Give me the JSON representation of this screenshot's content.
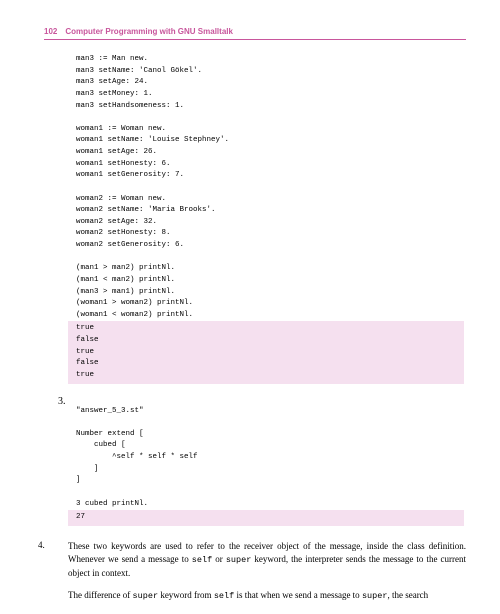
{
  "header": {
    "page_number": "102",
    "title": "Computer Programming with GNU Smalltalk"
  },
  "code1": "man3 := Man new.\nman3 setName: 'Canol Gökel'.\nman3 setAge: 24.\nman3 setMoney: 1.\nman3 setHandsomeness: 1.\n\nwoman1 := Woman new.\nwoman1 setName: 'Louise Stephney'.\nwoman1 setAge: 26.\nwoman1 setHonesty: 6.\nwoman1 setGenerosity: 7.\n\nwoman2 := Woman new.\nwoman2 setName: 'Maria Brooks'.\nwoman2 setAge: 32.\nwoman2 setHonesty: 8.\nwoman2 setGenerosity: 6.\n\n(man1 > man2) printNl.\n(man1 < man2) printNl.\n(man3 > man1) printNl.\n(woman1 > woman2) printNl.\n(woman1 < woman2) printNl.",
  "output1": "true\nfalse\ntrue\nfalse\ntrue",
  "list": {
    "item3_num": "3.",
    "item4_num": "4."
  },
  "code2": "\"answer_5_3.st\"\n\nNumber extend [\n    cubed [\n        ^self * self * self\n    ]\n]\n\n3 cubed printNl.",
  "output2": "27",
  "para4a_part1": "These two keywords are used to refer to the receiver object of the message, inside the class definition. Whenever we send a message to ",
  "para4a_self": "self",
  "para4a_part2": " or ",
  "para4a_super": "super",
  "para4a_part3": " keyword, the interpreter sends the message to the current object in context.",
  "para4b_part1": "The difference of ",
  "para4b_super": "super",
  "para4b_part2": " keyword from ",
  "para4b_self": "self",
  "para4b_part3": " is that when we send a message to ",
  "para4b_super2": "super",
  "para4b_part4": ", the search"
}
